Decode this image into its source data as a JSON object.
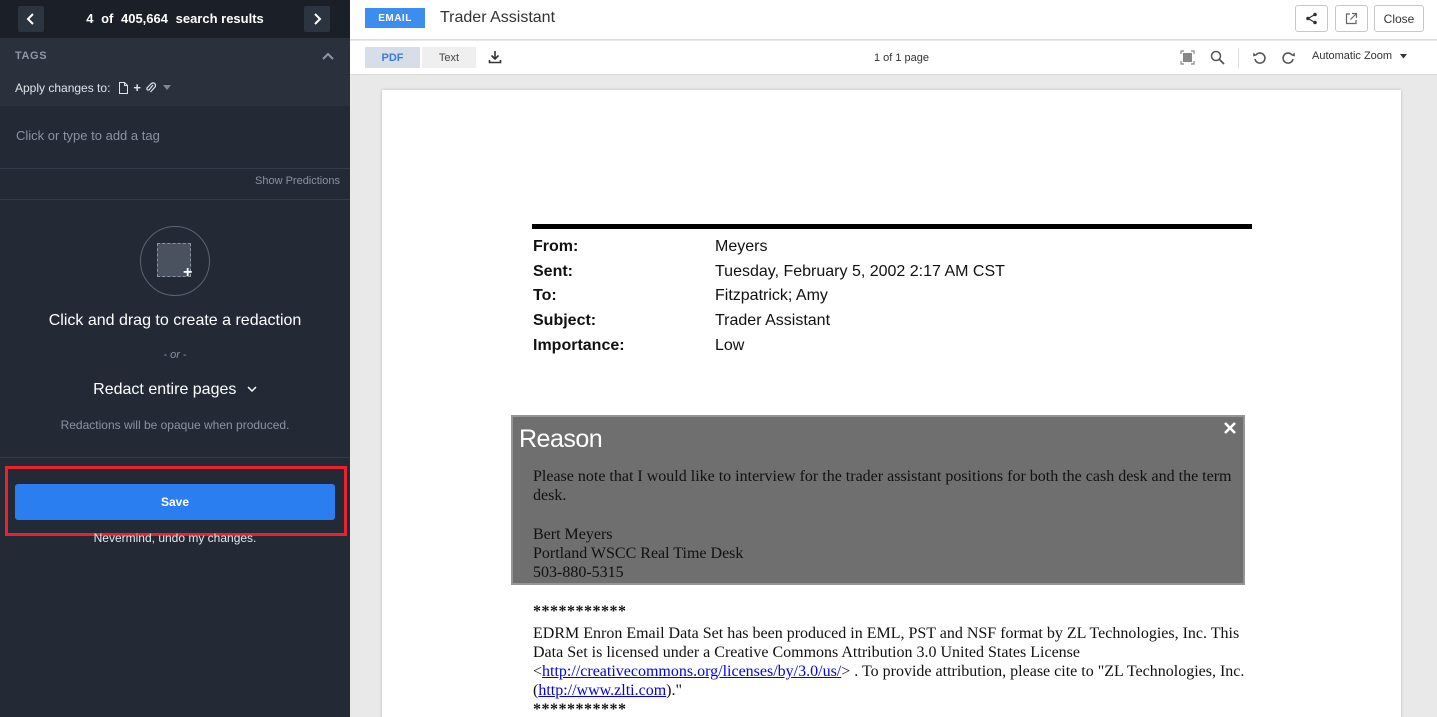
{
  "nav": {
    "current": "4",
    "of_label": "of",
    "total": "405,664",
    "suffix": "search results"
  },
  "tags": {
    "title": "TAGS",
    "apply_label": "Apply changes to:",
    "apply_plus": "+",
    "input_placeholder": "Click or type to add a tag",
    "show_predictions": "Show Predictions"
  },
  "redaction_panel": {
    "title": "Click and drag to create a redaction",
    "or_label": "- or -",
    "redact_pages": "Redact entire pages",
    "note": "Redactions will be opaque when produced."
  },
  "actions": {
    "save_label": "Save",
    "undo_label": "Nevermind, undo my changes."
  },
  "header": {
    "doc_type": "EMAIL",
    "title": "Trader Assistant",
    "close_label": "Close"
  },
  "toolbar": {
    "tab_pdf": "PDF",
    "tab_text": "Text",
    "page_count": "1 of 1 page",
    "zoom": "Automatic Zoom"
  },
  "email": {
    "fields": [
      {
        "label": "From:",
        "value": "Meyers"
      },
      {
        "label": "Sent:",
        "value": "Tuesday, February 5, 2002 2:17 AM CST"
      },
      {
        "label": "To:",
        "value": "Fitzpatrick; Amy"
      },
      {
        "label": "Subject:",
        "value": "Trader Assistant"
      },
      {
        "label": "Importance:",
        "value": "Low"
      }
    ],
    "redaction": {
      "reason": "Reason",
      "line1": "Please note that I would like to interview for the trader assistant positions for both the cash desk and the term desk.",
      "line2": "Bert Meyers",
      "line3": "Portland WSCC Real Time Desk",
      "line4": "503-880-5315"
    },
    "footer": {
      "stars": "***********",
      "p1": "EDRM Enron Email Data Set has been produced in EML, PST and NSF format by ZL Technologies, Inc. This Data Set is licensed under a Creative Commons Attribution 3.0 United States License",
      "lt": "<",
      "license_url": "http://creativecommons.org/licenses/by/3.0/us/",
      "p2": "> . To provide attribution, please cite to \"ZL Technologies, Inc. (",
      "zl_url": "http://www.zlti.com",
      "p3": ").\""
    }
  },
  "colors": {
    "sidebar_bg": "#232a36",
    "accent_blue": "#2b7ef0",
    "highlight_red": "#e8222e",
    "redaction_gray": "#6f6f6f"
  },
  "icons": [
    "chevron-left-icon",
    "chevron-right-icon",
    "chevron-up-icon",
    "document-icon",
    "paperclip-icon",
    "share-icon",
    "popout-icon",
    "download-icon",
    "fit-page-icon",
    "search-icon",
    "rotate-left-icon",
    "rotate-right-icon",
    "close-icon"
  ]
}
